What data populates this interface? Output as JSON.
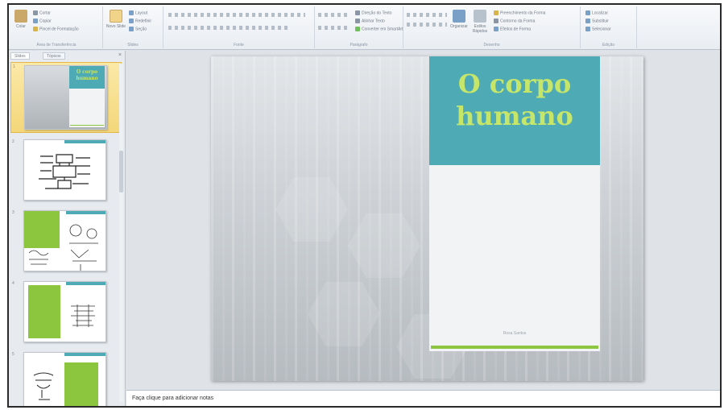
{
  "ribbon": {
    "groups": [
      {
        "label": "Área de Transferência"
      },
      {
        "label": "Slides"
      },
      {
        "label": "Fonte"
      },
      {
        "label": "Parágrafo"
      },
      {
        "label": "Desenho"
      },
      {
        "label": "Edição"
      }
    ],
    "clipboard": {
      "paste": "Colar",
      "cut": "Cortar",
      "copy": "Copiar",
      "format_painter": "Pincel de Formatação"
    },
    "slides": {
      "new_slide": "Novo Slide",
      "layout": "Layout",
      "reset": "Redefinir",
      "section": "Seção"
    },
    "paragraph": {
      "text_direction": "Direção do Texto",
      "align_text": "Alinhar Texto",
      "smartart": "Converter em SmartArt"
    },
    "drawing": {
      "arrange": "Organizar",
      "quick_styles": "Estilos Rápidos",
      "shape_fill": "Preenchimento da Forma",
      "shape_outline": "Contorno da Forma",
      "shape_effects": "Efeitos de Forma"
    },
    "editing": {
      "find": "Localizar",
      "replace": "Substituir",
      "select": "Selecionar"
    }
  },
  "panel": {
    "tabs": [
      "Slides",
      "Tópicos"
    ],
    "close": "×",
    "thumbnails": [
      {
        "number": "1",
        "title": "O corpo humano"
      },
      {
        "number": "2"
      },
      {
        "number": "3"
      },
      {
        "number": "4"
      },
      {
        "number": "5"
      }
    ]
  },
  "slide": {
    "title": "O corpo humano",
    "author": "Rosa Santos"
  },
  "notes": {
    "placeholder": "Faça clique para adicionar notas"
  },
  "colors": {
    "teal": "#4eaab5",
    "title_green": "#c6e66a",
    "accent_green": "#8cc63e"
  }
}
